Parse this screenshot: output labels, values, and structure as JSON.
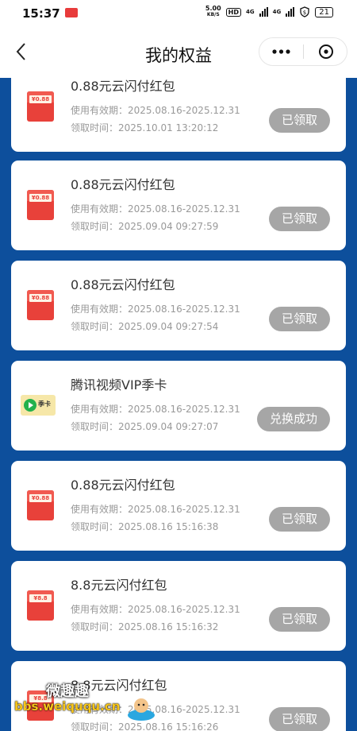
{
  "status_bar": {
    "time": "15:37",
    "net_speed": "5.00",
    "net_unit": "KB/S",
    "hd": "HD",
    "sig1": "4G",
    "sig2": "4G",
    "battery": "21"
  },
  "nav": {
    "title": "我的权益",
    "back_icon": "chevron-left-icon",
    "more_icon": "more-dots-icon",
    "close_icon": "close-circle-icon"
  },
  "colors": {
    "page_bg": "#0d4f9c",
    "button_gray": "#a6a6a6",
    "envelope_red": "#e8413a"
  },
  "cards": [
    {
      "title": "0.88元云闪付红包",
      "valid": "使用有效期：2025.08.16-2025.12.31",
      "time": "领取时间：2025.10.01 13:20:12",
      "button": "已领取",
      "icon": "red-envelope-icon",
      "icon_text": "¥0.88"
    },
    {
      "title": "0.88元云闪付红包",
      "valid": "使用有效期：2025.08.16-2025.12.31",
      "time": "领取时间：2025.09.04 09:27:59",
      "button": "已领取",
      "icon": "red-envelope-icon",
      "icon_text": "¥0.88"
    },
    {
      "title": "0.88元云闪付红包",
      "valid": "使用有效期：2025.08.16-2025.12.31",
      "time": "领取时间：2025.09.04 09:27:54",
      "button": "已领取",
      "icon": "red-envelope-icon",
      "icon_text": "¥0.88"
    },
    {
      "title": "腾讯视频VIP季卡",
      "valid": "使用有效期：2025.08.16-2025.12.31",
      "time": "领取时间：2025.09.04 09:27:07",
      "button": "兑换成功",
      "icon": "video-ticket-icon",
      "icon_text": "季卡"
    },
    {
      "title": "0.88元云闪付红包",
      "valid": "使用有效期：2025.08.16-2025.12.31",
      "time": "领取时间：2025.08.16 15:16:38",
      "button": "已领取",
      "icon": "red-envelope-icon",
      "icon_text": "¥0.88"
    },
    {
      "title": "8.8元云闪付红包",
      "valid": "使用有效期：2025.08.16-2025.12.31",
      "time": "领取时间：2025.08.16 15:16:32",
      "button": "已领取",
      "icon": "red-envelope-icon",
      "icon_text": "¥8.8"
    },
    {
      "title": "8.8元云闪付红包",
      "valid": "使用有效期：2025.08.16-2025.12.31",
      "time": "领取时间：2025.08.16 15:16:26",
      "button": "已领取",
      "icon": "red-envelope-icon",
      "icon_text": "¥8.8"
    }
  ],
  "watermark": {
    "title": "微趣趣",
    "url": "bbs.weiququ.cn"
  }
}
